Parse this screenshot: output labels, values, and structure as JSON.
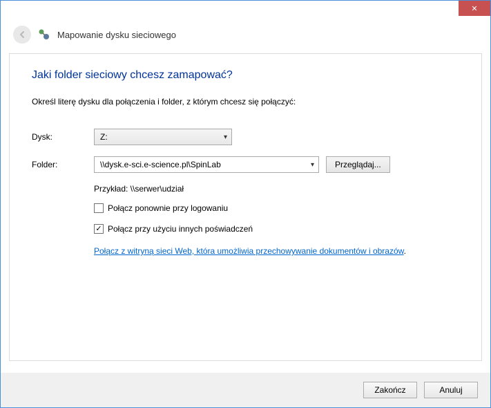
{
  "title_bar": {
    "close_glyph": "✕"
  },
  "header": {
    "title": "Mapowanie dysku sieciowego"
  },
  "content": {
    "heading": "Jaki folder sieciowy chcesz zamapować?",
    "instruction": "Określ literę dysku dla połączenia i folder, z którym chcesz się połączyć:",
    "drive_label": "Dysk:",
    "drive_value": "Z:",
    "folder_label": "Folder:",
    "folder_value": "\\\\dysk.e-sci.e-science.pl\\SpinLab",
    "browse_label": "Przeglądaj...",
    "example_text": "Przykład: \\\\serwer\\udział",
    "reconnect_label": "Połącz ponownie przy logowaniu",
    "reconnect_checked": false,
    "other_creds_label": "Połącz przy użyciu innych poświadczeń",
    "other_creds_checked": true,
    "link_text": "Połącz z witryną sieci Web, która umożliwia przechowywanie dokumentów i obrazów",
    "link_period": "."
  },
  "footer": {
    "finish_label": "Zakończ",
    "cancel_label": "Anuluj"
  }
}
